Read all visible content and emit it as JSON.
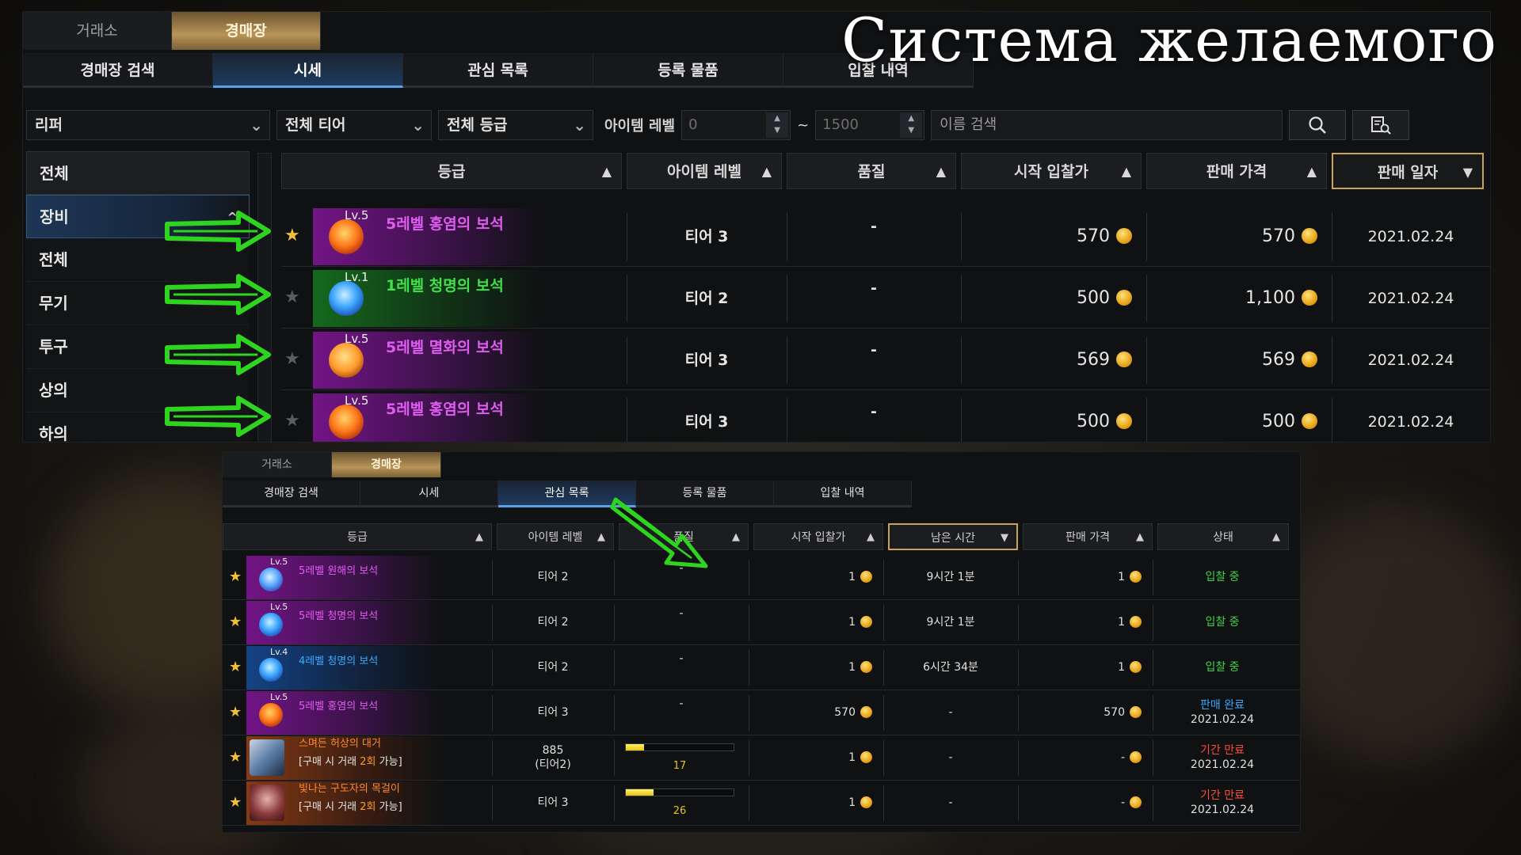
{
  "overlay_title": "Система желаемого",
  "colors": {
    "gold_tab": "#b89457",
    "blue_tab": "#1e3a5e",
    "rarity_purple": "#e05cf0",
    "rarity_green": "#3fe04a",
    "rarity_blue": "#3ca9ff",
    "rarity_orange": "#ff8a2a",
    "status_green": "#3fd24a",
    "status_blue": "#39a8ff",
    "status_red": "#ff4a3a",
    "arrow_green": "#2ed41f"
  },
  "top": {
    "tabs_main": [
      "거래소",
      "경매장"
    ],
    "tabs_sub": [
      "경매장 검색",
      "시세",
      "관심 목록",
      "등록 물품",
      "입찰 내역"
    ],
    "filters": {
      "class": "리퍼",
      "tier": "전체 티어",
      "grade": "전체 등급",
      "item_level_label": "아이템 레벨",
      "level_min": "0",
      "level_sep": "~",
      "level_max": "1500",
      "search_placeholder": "이름 검색",
      "search_icon": "search-icon",
      "filter_icon": "list-search-icon"
    },
    "sidebar": [
      {
        "label": "전체",
        "type": "head"
      },
      {
        "label": "장비",
        "type": "active",
        "caret": "^"
      },
      {
        "label": "전체"
      },
      {
        "label": "무기"
      },
      {
        "label": "투구"
      },
      {
        "label": "상의"
      },
      {
        "label": "하의"
      }
    ],
    "columns": [
      {
        "label": "등급",
        "arrow": "▲"
      },
      {
        "label": "아이템 레벨",
        "arrow": "▲"
      },
      {
        "label": "품질",
        "arrow": "▲"
      },
      {
        "label": "시작 입찰가",
        "arrow": "▲"
      },
      {
        "label": "판매 가격",
        "arrow": "▲"
      },
      {
        "label": "판매 일자",
        "arrow": "▼"
      }
    ],
    "rows": [
      {
        "starred": true,
        "level": "Lv.5",
        "name": "5레벨 홍염의 보석",
        "rarity": "purple",
        "gem": "fire",
        "tier": "티어 3",
        "quality": "-",
        "start_bid": "570",
        "price": "570",
        "date": "2021.02.24"
      },
      {
        "starred": false,
        "level": "Lv.1",
        "name": "1레벨 청명의 보석",
        "rarity": "green",
        "gem": "blue",
        "tier": "티어 2",
        "quality": "-",
        "start_bid": "500",
        "price": "1,100",
        "date": "2021.02.24"
      },
      {
        "starred": false,
        "level": "Lv.5",
        "name": "5레벨 멸화의 보석",
        "rarity": "purple",
        "gem": "ember",
        "tier": "티어 3",
        "quality": "-",
        "start_bid": "569",
        "price": "569",
        "date": "2021.02.24"
      },
      {
        "starred": false,
        "level": "Lv.5",
        "name": "5레벨 홍염의 보석",
        "rarity": "purple",
        "gem": "fire",
        "tier": "티어 3",
        "quality": "-",
        "start_bid": "500",
        "price": "500",
        "date": "2021.02.24"
      }
    ]
  },
  "bottom": {
    "tabs_main": [
      "거래소",
      "경매장"
    ],
    "tabs_sub": [
      "경매장 검색",
      "시세",
      "관심 목록",
      "등록 물품",
      "입찰 내역"
    ],
    "columns": [
      {
        "label": "등급",
        "arrow": "▲"
      },
      {
        "label": "아이템 레벨",
        "arrow": "▲"
      },
      {
        "label": "품질",
        "arrow": "▲"
      },
      {
        "label": "시작 입찰가",
        "arrow": "▲"
      },
      {
        "label": "남은 시간",
        "arrow": "▼"
      },
      {
        "label": "판매 가격",
        "arrow": "▲"
      },
      {
        "label": "상태",
        "arrow": "▲"
      }
    ],
    "rows": [
      {
        "level": "Lv.5",
        "name": "5레벨 원해의 보석",
        "rarity": "purple",
        "gem": "sea",
        "item_level": "티어 2",
        "quality": "-",
        "start_bid": "1",
        "remaining": "9시간 1분",
        "price": "1",
        "status": "입찰 중",
        "status_color": "green",
        "status_date": ""
      },
      {
        "level": "Lv.5",
        "name": "5레벨 청명의 보석",
        "rarity": "purple",
        "gem": "blue",
        "item_level": "티어 2",
        "quality": "-",
        "start_bid": "1",
        "remaining": "9시간 1분",
        "price": "1",
        "status": "입찰 중",
        "status_color": "green",
        "status_date": ""
      },
      {
        "level": "Lv.4",
        "name": "4레벨 청명의 보석",
        "rarity": "blue",
        "gem": "blue",
        "item_level": "티어 2",
        "quality": "-",
        "start_bid": "1",
        "remaining": "6시간 34분",
        "price": "1",
        "status": "입찰 중",
        "status_color": "green",
        "status_date": ""
      },
      {
        "level": "Lv.5",
        "name": "5레벨 홍염의 보석",
        "rarity": "purple",
        "gem": "fire",
        "item_level": "티어 3",
        "quality": "-",
        "start_bid": "570",
        "remaining": "-",
        "price": "570",
        "status": "판매 완료",
        "status_color": "blue",
        "status_date": "2021.02.24"
      },
      {
        "level": "",
        "name": "스며든 허상의 대거",
        "sub_a": "[구매 시 거래 ",
        "sub_b": "2회",
        "sub_c": " 가능]",
        "rarity": "orange",
        "gem": "dagger",
        "item_level": "885",
        "item_level_sub": "(티어2)",
        "quality_value": 17,
        "start_bid": "1",
        "remaining": "-",
        "price": "-",
        "status": "기간 만료",
        "status_color": "red",
        "status_date": "2021.02.24"
      },
      {
        "level": "",
        "name": "빛나는 구도자의 목걸이",
        "sub_a": "[구매 시 거래 ",
        "sub_b": "2회",
        "sub_c": " 가능]",
        "rarity": "orange",
        "gem": "necklace",
        "item_level": "티어 3",
        "quality_value": 26,
        "start_bid": "1",
        "remaining": "-",
        "price": "-",
        "status": "기간 만료",
        "status_color": "red",
        "status_date": "2021.02.24"
      }
    ]
  }
}
